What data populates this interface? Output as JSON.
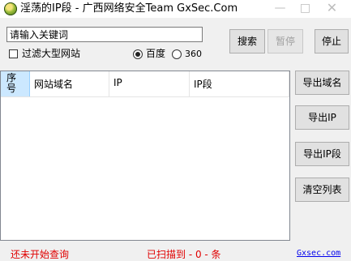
{
  "window": {
    "title": "淫荡的IP段 - 广西网络安全Team GxSec.Com",
    "min_glyph": "—",
    "max_glyph": "□",
    "close_glyph": "✕"
  },
  "search": {
    "value": "请输入关键词"
  },
  "filter": {
    "label": "过滤大型网站",
    "checked": false
  },
  "engine": {
    "options": [
      {
        "label": "百度",
        "selected": true
      },
      {
        "label": "360",
        "selected": false
      }
    ]
  },
  "buttons": {
    "search": "搜索",
    "pause": "暂停",
    "stop": "停止",
    "export_domain": "导出域名",
    "export_ip": "导出IP",
    "export_ipseg": "导出IP段",
    "clear": "清空列表"
  },
  "table": {
    "columns": [
      "序号",
      "网站域名",
      "IP",
      "IP段"
    ],
    "rows": []
  },
  "status": {
    "left": "还未开始查询",
    "center": "已扫描到 - 0 - 条",
    "link": "Gxsec.com"
  },
  "colors": {
    "status_text": "#e00000",
    "link": "#0000ee",
    "selected_header": "#cce8ff"
  },
  "icons": {
    "app": "app-icon",
    "minimize": "minimize-icon",
    "maximize": "maximize-icon",
    "close": "close-icon"
  }
}
